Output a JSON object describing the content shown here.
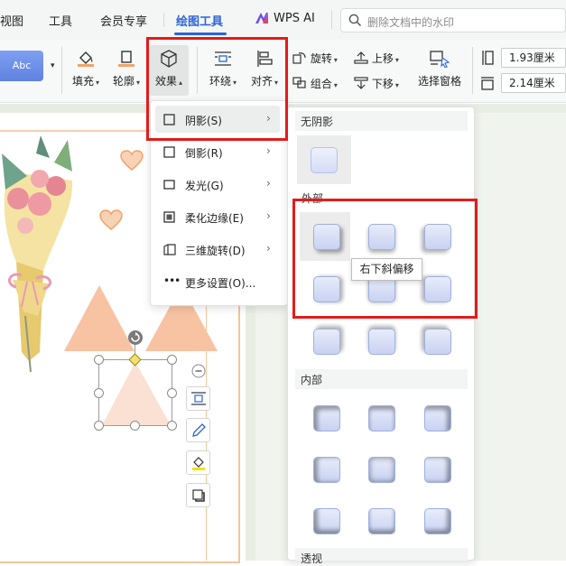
{
  "tabs": [
    {
      "label": "视图"
    },
    {
      "label": "工具"
    },
    {
      "label": "会员专享"
    },
    {
      "label": "绘图工具"
    },
    {
      "label": "WPS AI"
    }
  ],
  "search": {
    "placeholder": "删除文档中的水印"
  },
  "ribbon": {
    "style_sample": "Abc",
    "fill": "填充",
    "outline": "轮廓",
    "effect": "效果",
    "wrap": "环绕",
    "align": "对齐",
    "rotate": "旋转",
    "group": "组合",
    "bring_up": "上移",
    "send_down": "下移",
    "selection_pane": "选择窗格",
    "width_value": "1.93厘米",
    "height_value": "2.14厘米"
  },
  "effect_menu": {
    "items": [
      {
        "label": "阴影(S)",
        "has_submenu": true
      },
      {
        "label": "倒影(R)",
        "has_submenu": true
      },
      {
        "label": "发光(G)",
        "has_submenu": true
      },
      {
        "label": "柔化边缘(E)",
        "has_submenu": true
      },
      {
        "label": "三维旋转(D)",
        "has_submenu": true
      },
      {
        "label": "更多设置(O)...",
        "has_submenu": false
      }
    ]
  },
  "shadow_panel": {
    "sections": [
      {
        "title": "无阴影"
      },
      {
        "title": "外部"
      },
      {
        "title": "内部"
      },
      {
        "title": "透视"
      }
    ]
  },
  "tooltip": {
    "text": "右下斜偏移"
  },
  "colors": {
    "accent": "#2c64d8",
    "annotation_red": "#e31b1b",
    "shape_peach": "#f7c3a3",
    "heart_orange": "#f0a36a",
    "page_border": "#f2c59c"
  }
}
